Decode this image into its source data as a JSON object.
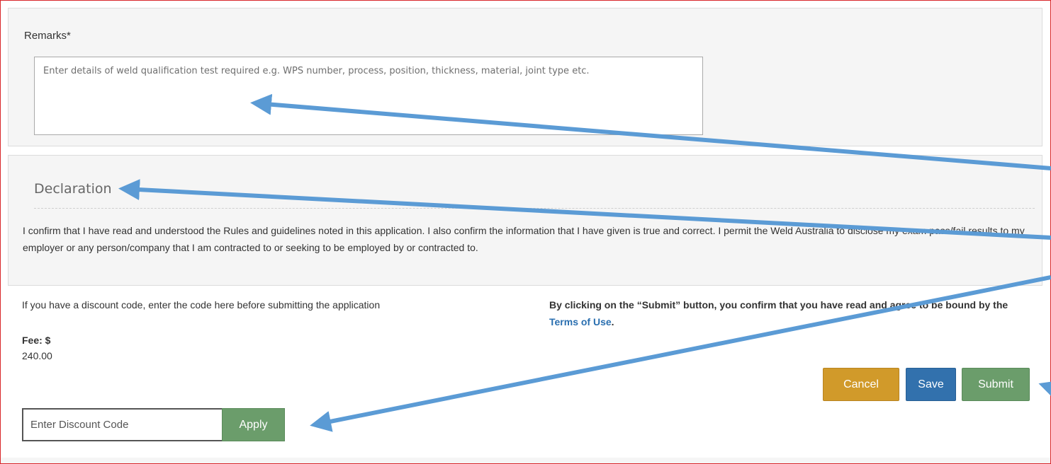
{
  "remarks": {
    "label": "Remarks*",
    "placeholder": "Enter details of weld qualification test required e.g. WPS number, process, position, thickness, material, joint type etc."
  },
  "declaration": {
    "title": "Declaration",
    "text": "I confirm that I have read and understood the Rules and guidelines noted in this application. I also confirm the information that I have given is true and correct. I permit the Weld Australia to disclose my exam pass/fail results to my employer or any person/company that I am contracted to or seeking to be employed by or contracted to."
  },
  "discount": {
    "note": "If you have a discount code, enter the code here before submitting the application",
    "fee_label": "Fee: $",
    "fee_value": "240.00",
    "placeholder": "Enter Discount Code",
    "apply_label": "Apply"
  },
  "submit_note": {
    "text_before": "By clicking on the “Submit” button, you confirm that you have read and agree to be bound by the ",
    "link_text": "Terms of Use",
    "text_after": "."
  },
  "actions": {
    "cancel_label": "Cancel",
    "save_label": "Save",
    "submit_label": "Submit"
  },
  "colors": {
    "frame_border": "#d9262a",
    "annotation_arrow": "#5b9bd5",
    "cancel_button": "#d19a2a",
    "save_button": "#3271ad",
    "submit_button": "#6b9d6b",
    "apply_button": "#6b9d6b",
    "link": "#2a6fb0"
  }
}
